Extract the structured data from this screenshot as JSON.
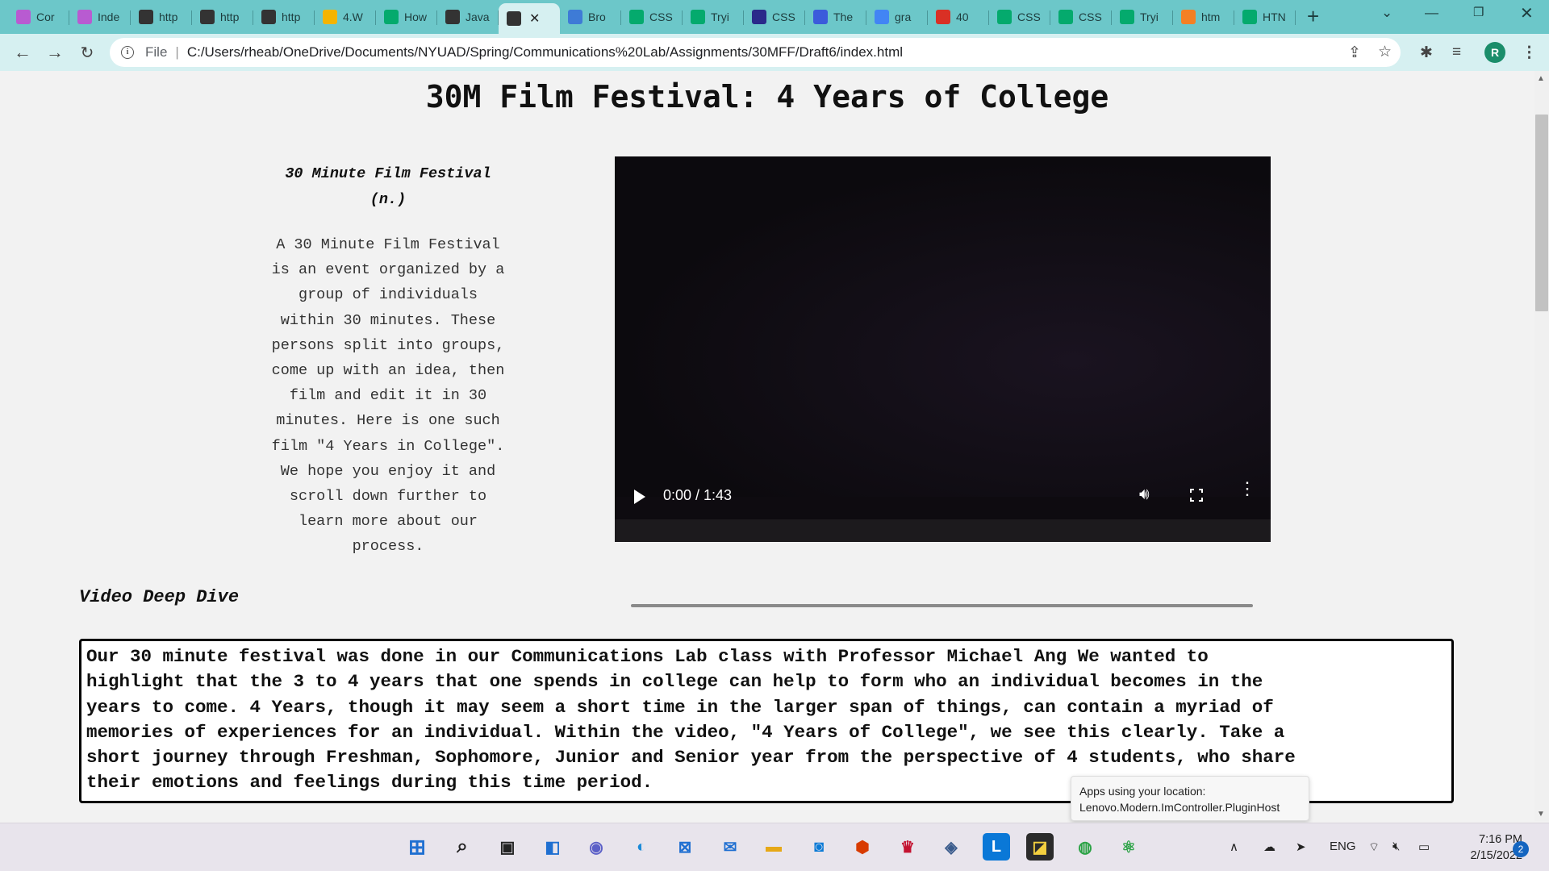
{
  "browser": {
    "tabs": [
      {
        "title": "Cor",
        "icon": "codelab-icon",
        "color": "#b85bd1"
      },
      {
        "title": "Inde",
        "icon": "codelab-icon",
        "color": "#b85bd1"
      },
      {
        "title": "http",
        "icon": "globe-icon",
        "color": "#333333"
      },
      {
        "title": "http",
        "icon": "globe-icon",
        "color": "#333333"
      },
      {
        "title": "http",
        "icon": "globe-icon",
        "color": "#333333"
      },
      {
        "title": "4.W",
        "icon": "slides-icon",
        "color": "#f4b400"
      },
      {
        "title": "How",
        "icon": "w3schools-icon",
        "color": "#04aa6d"
      },
      {
        "title": "Java",
        "icon": "globe-icon",
        "color": "#333333"
      },
      {
        "title": "",
        "icon": "globe-icon",
        "color": "#333333",
        "active": true
      },
      {
        "title": "Bro",
        "icon": "grid-icon",
        "color": "#3e7bd6"
      },
      {
        "title": "CSS",
        "icon": "w3schools-icon",
        "color": "#04aa6d"
      },
      {
        "title": "Tryi",
        "icon": "w3schools-icon",
        "color": "#04aa6d"
      },
      {
        "title": "CSS",
        "icon": "cssbox-icon",
        "color": "#2a2a8a"
      },
      {
        "title": "The",
        "icon": "hashnode-icon",
        "color": "#3b5bdb"
      },
      {
        "title": "gra",
        "icon": "google-icon",
        "color": "#4285f4"
      },
      {
        "title": "40",
        "icon": "pdf-icon",
        "color": "#d93025"
      },
      {
        "title": "CSS",
        "icon": "w3schools-icon",
        "color": "#04aa6d"
      },
      {
        "title": "CSS",
        "icon": "w3schools-icon",
        "color": "#04aa6d"
      },
      {
        "title": "Tryi",
        "icon": "w3schools-icon",
        "color": "#04aa6d"
      },
      {
        "title": "htm",
        "icon": "stackoverflow-icon",
        "color": "#f48024"
      },
      {
        "title": "HTN",
        "icon": "w3schools-icon",
        "color": "#04aa6d"
      }
    ],
    "address_scheme": "File",
    "address_url": "C:/Users/rheab/OneDrive/Documents/NYUAD/Spring/Communications%20Lab/Assignments/30MFF/Draft6/index.html",
    "profile_initial": "R"
  },
  "page": {
    "title": "30M Film Festival: 4 Years of College",
    "definition_term_line1": "30 Minute Film Festival",
    "definition_term_line2": "(n.)",
    "definition_lines": [
      "A 30 Minute Film Festival",
      "is an event organized by a",
      "group of individuals",
      "within 30 minutes. These",
      "persons split into groups,",
      "come up with an idea, then",
      "film and edit it in 30",
      "minutes. Here is one such",
      "film \"4 Years in College\".",
      "We hope you enjoy it and",
      "scroll down further to",
      "learn more about our",
      "process."
    ],
    "video": {
      "time": "0:00 / 1:43",
      "progress": 0.0
    },
    "section_heading": "Video Deep Dive",
    "deep_dive_lines": [
      "Our 30 minute festival was done in our Communications Lab class with Professor Michael Ang We wanted to",
      "highlight that the 3 to 4 years that one spends in college can help to form who an individual becomes in the",
      "years to come. 4 Years, though it may seem a short time in the larger span of things, can contain a myriad of",
      "memories of experiences for an individual. Within the video, \"4 Years of College\", we see this clearly. Take a",
      "short journey through Freshman, Sophomore, Junior and Senior year from the perspective of 4 students, who share",
      "their emotions and feelings during this time period."
    ]
  },
  "toast": {
    "line1": "Apps using your location:",
    "line2": "Lenovo.Modern.ImController.PluginHost"
  },
  "taskbar": {
    "language": "ENG",
    "time": "7:16 PM",
    "date": "2/15/2022",
    "notification_count": "2"
  },
  "colors": {
    "tab_strip": "#6cc7c9",
    "toolbar": "#d6f0f1",
    "page_bg": "#f2f2f2"
  }
}
